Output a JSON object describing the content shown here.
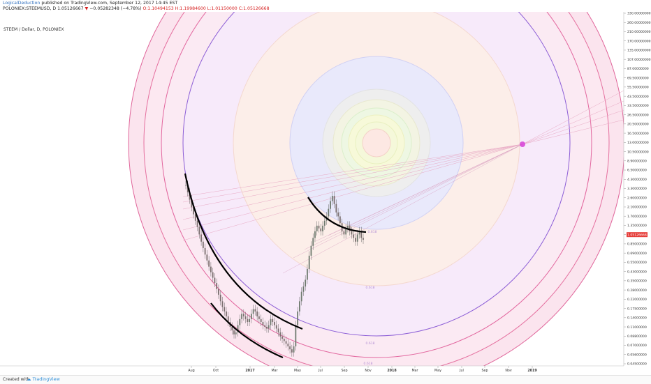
{
  "header": {
    "username": "LogicalDeduction",
    "published_text": "published on TradingView.com, September 12, 2017 14:45 EST",
    "symbol": "POLONIEX:STEEMUSD, D",
    "last": "1.05126667",
    "change": "−0.05282348 (−4.78%)",
    "open_label": "O:",
    "open": "1.10494153",
    "high_label": "H:",
    "high": "1.19984600",
    "low_label": "L:",
    "low": "1.01150000",
    "close_label": "C:",
    "close": "1.05126668"
  },
  "footer": {
    "created_with": "Created with",
    "brand": "TradingView"
  },
  "colors": {
    "price_label": "#e53935",
    "candle_up": "#6e7a6e",
    "candle_down": "#7a6e6e",
    "curve": "#000000",
    "pivot_point": "#d63fd6"
  },
  "chart_data": {
    "type": "candlestick",
    "title": "STEEM / Dollar, D, POLONIEX",
    "y_scale": "log",
    "y_ticks": [
      "330.00000000",
      "260.00000000",
      "210.00000000",
      "170.00000000",
      "135.00000000",
      "107.00000000",
      "87.00000000",
      "69.50000000",
      "55.50000000",
      "43.50000000",
      "33.50000000",
      "26.50000000",
      "20.50000000",
      "16.50000000",
      "13.00000000",
      "10.50000000",
      "8.90000000",
      "6.50000000",
      "4.30000000",
      "3.30000000",
      "2.60000000",
      "2.10000000",
      "1.70000000",
      "1.35000000",
      "1.05126668",
      "0.85000000",
      "0.69000000",
      "0.55000000",
      "0.43000000",
      "0.35000000",
      "0.28000000",
      "0.22000000",
      "0.17500000",
      "0.14000000",
      "0.11000000",
      "0.08800000",
      "0.07000000",
      "0.05600000",
      "0.04500000"
    ],
    "current_price": "1.05126668",
    "x_ticks": [
      "Aug",
      "Oct",
      "2017",
      "Mar",
      "May",
      "Jul",
      "Sep",
      "Nov",
      "2018",
      "Mar",
      "May",
      "Jul",
      "Sep",
      "Nov",
      "2019"
    ],
    "circle_labels": [
      "0.618",
      "0.618",
      "0.618",
      "0.618"
    ],
    "series": [
      {
        "values": [
          4.2,
          3.5,
          2.9,
          2.4,
          2.0,
          1.7,
          1.45,
          1.2,
          1.0,
          0.85,
          0.72,
          0.62,
          0.53,
          0.46,
          0.4,
          0.35,
          0.3,
          0.26,
          0.22,
          0.19,
          0.17,
          0.15,
          0.13,
          0.115,
          0.105,
          0.095,
          0.1,
          0.12,
          0.14,
          0.16,
          0.15,
          0.14,
          0.13,
          0.14,
          0.16,
          0.18,
          0.17,
          0.15,
          0.14,
          0.13,
          0.12,
          0.115,
          0.11,
          0.12,
          0.14,
          0.13,
          0.12,
          0.11,
          0.1,
          0.09,
          0.085,
          0.08,
          0.075,
          0.07,
          0.065,
          0.06,
          0.07,
          0.12,
          0.17,
          0.22,
          0.28,
          0.32,
          0.38,
          0.5,
          0.7,
          0.9,
          1.1,
          1.3,
          1.5,
          1.4,
          1.3,
          1.5,
          1.7,
          1.9,
          2.3,
          2.8,
          3.2,
          2.6,
          2.1,
          1.9,
          1.6,
          1.3,
          1.2,
          1.4,
          1.5,
          1.3,
          1.2,
          1.1,
          1.0,
          1.2,
          1.3,
          1.1,
          1.05
        ]
      }
    ]
  }
}
